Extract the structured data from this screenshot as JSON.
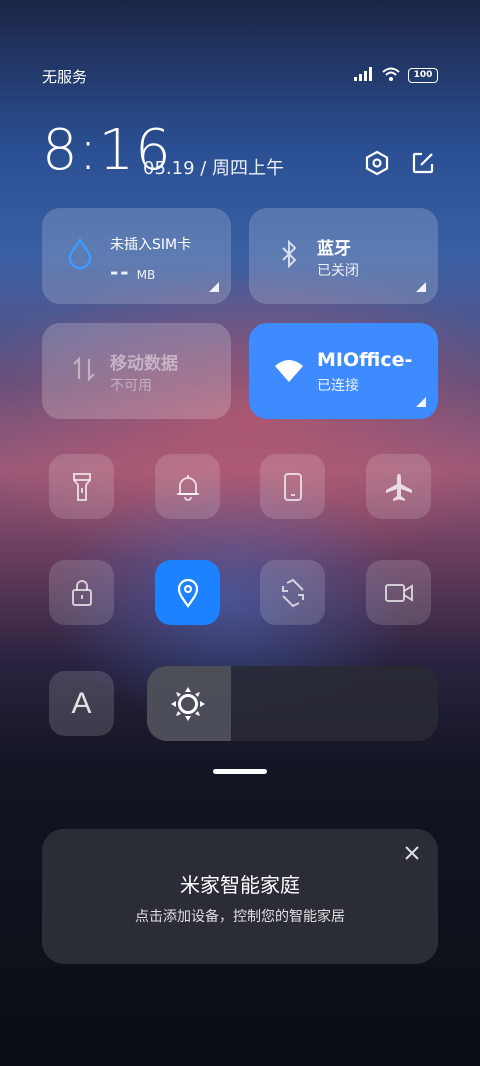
{
  "status_bar": {
    "carrier": "无服务",
    "battery": "100"
  },
  "header": {
    "time": "8:16",
    "date": "05.19 / 周四上午"
  },
  "tiles": {
    "sim": {
      "title": "未插入SIM卡",
      "value": "--",
      "unit": "MB"
    },
    "bluetooth": {
      "title": "蓝牙",
      "status": "已关闭"
    },
    "mobile_data": {
      "title": "移动数据",
      "status": "不可用"
    },
    "wifi": {
      "title": "MIOffice-",
      "status": "已连接"
    }
  },
  "toggles": [
    {
      "icon": "flashlight-icon",
      "active": false
    },
    {
      "icon": "bell-icon",
      "active": false
    },
    {
      "icon": "phone-icon",
      "active": false
    },
    {
      "icon": "airplane-icon",
      "active": false
    },
    {
      "icon": "lock-icon",
      "active": false
    },
    {
      "icon": "location-icon",
      "active": true
    },
    {
      "icon": "rotate-icon",
      "active": false
    },
    {
      "icon": "video-icon",
      "active": false
    }
  ],
  "brightness": {
    "level": 0.29
  },
  "font_toggle": {
    "label": "A"
  },
  "mijia_card": {
    "title": "米家智能家庭",
    "subtitle": "点击添加设备，控制您的智能家居"
  },
  "colors": {
    "accent": "#3d8bff",
    "active_toggle": "#1d82ff"
  }
}
